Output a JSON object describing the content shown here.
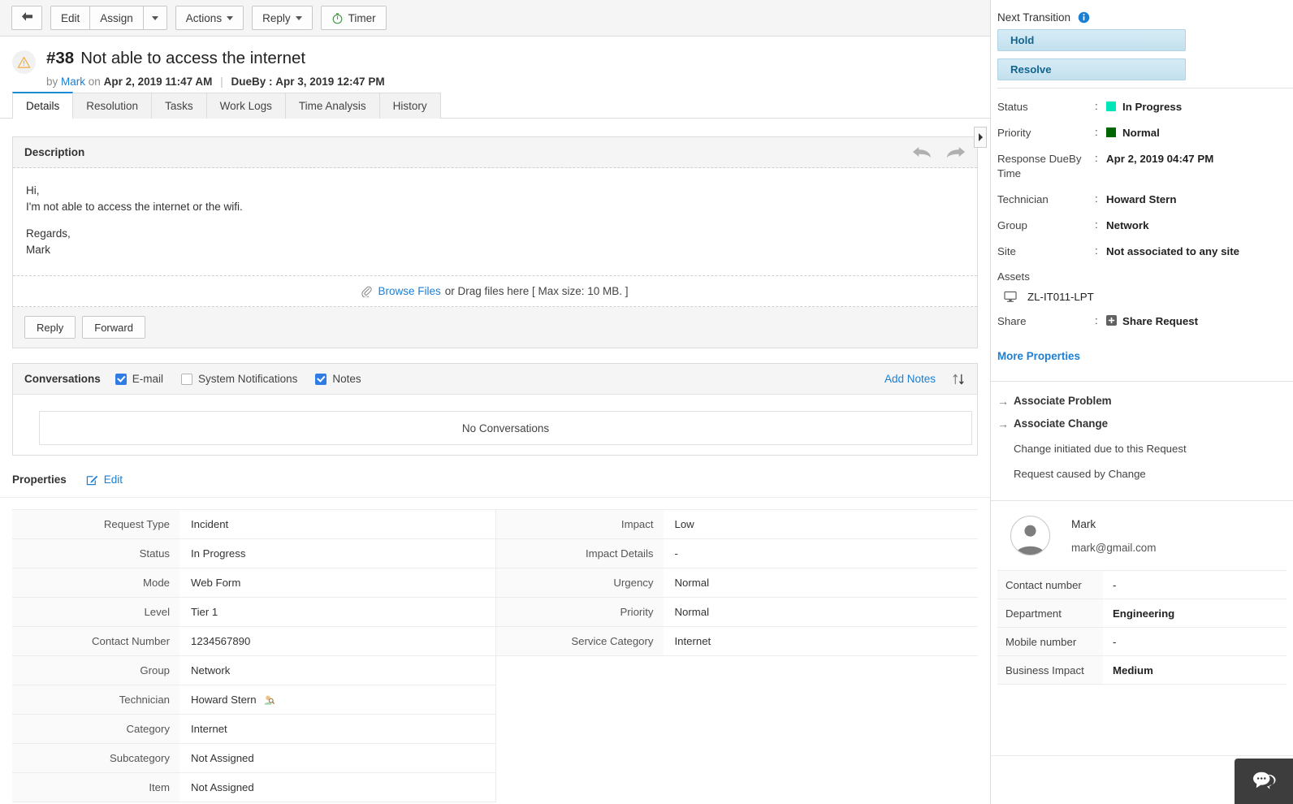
{
  "toolbar": {
    "back_label": "back-arrow",
    "edit_label": "Edit",
    "assign_label": "Assign",
    "actions_label": "Actions",
    "reply_label": "Reply",
    "timer_label": "Timer"
  },
  "request": {
    "id": "#38",
    "title": "Not able to access the internet",
    "by_prefix": "by",
    "requester": "Mark",
    "on_prefix": "on",
    "created": "Apr 2, 2019 11:47 AM",
    "dueby_label": "DueBy :",
    "dueby": "Apr 3, 2019 12:47 PM"
  },
  "tabs": [
    {
      "label": "Details",
      "active": true
    },
    {
      "label": "Resolution",
      "active": false
    },
    {
      "label": "Tasks",
      "active": false
    },
    {
      "label": "Work Logs",
      "active": false
    },
    {
      "label": "Time Analysis",
      "active": false
    },
    {
      "label": "History",
      "active": false
    }
  ],
  "description": {
    "heading": "Description",
    "line1": "Hi,",
    "line2": "I'm not able to access the internet or the wifi.",
    "line3": "Regards,",
    "line4": "Mark",
    "attach_link": "Browse Files",
    "attach_rest": "or Drag files here [ Max size: 10 MB. ]",
    "reply_button": "Reply",
    "forward_button": "Forward"
  },
  "conversations": {
    "heading": "Conversations",
    "filters": [
      {
        "label": "E-mail",
        "checked": true
      },
      {
        "label": "System Notifications",
        "checked": false
      },
      {
        "label": "Notes",
        "checked": true
      }
    ],
    "add_notes": "Add Notes",
    "empty_text": "No Conversations"
  },
  "properties": {
    "heading": "Properties",
    "edit_label": "Edit",
    "left": [
      {
        "key": "Request Type",
        "value": "Incident"
      },
      {
        "key": "Status",
        "value": "In Progress"
      },
      {
        "key": "Mode",
        "value": "Web Form"
      },
      {
        "key": "Level",
        "value": "Tier 1"
      },
      {
        "key": "Contact Number",
        "value": "1234567890"
      },
      {
        "key": "Group",
        "value": "Network"
      },
      {
        "key": "Technician",
        "value": "Howard Stern",
        "icon": "technician-icon"
      },
      {
        "key": "Category",
        "value": "Internet"
      },
      {
        "key": "Subcategory",
        "value": "Not Assigned"
      },
      {
        "key": "Item",
        "value": "Not Assigned"
      }
    ],
    "right": [
      {
        "key": "Impact",
        "value": "Low"
      },
      {
        "key": "Impact Details",
        "value": "-"
      },
      {
        "key": "Urgency",
        "value": "Normal"
      },
      {
        "key": "Priority",
        "value": "Normal"
      },
      {
        "key": "Service Category",
        "value": "Internet"
      }
    ]
  },
  "sidebar": {
    "next_transition_label": "Next Transition",
    "transitions": [
      {
        "label": "Hold"
      },
      {
        "label": "Resolve"
      }
    ],
    "fields": [
      {
        "key": "Status",
        "value": "In Progress",
        "swatch": "#00e6b8"
      },
      {
        "key": "Priority",
        "value": "Normal",
        "swatch": "#006400"
      },
      {
        "key": "Response DueBy Time",
        "value": "Apr 2, 2019 04:47 PM"
      },
      {
        "key": "Technician",
        "value": "Howard Stern"
      },
      {
        "key": "Group",
        "value": "Network"
      },
      {
        "key": "Site",
        "value": "Not associated to any site"
      }
    ],
    "assets_label": "Assets",
    "asset_name": "ZL-IT011-LPT",
    "share_key": "Share",
    "share_value": "Share Request",
    "more_properties": "More Properties",
    "associations": {
      "problem_label": "Associate Problem",
      "change_label": "Associate Change",
      "change_note": "Change initiated due to this Request",
      "caused_note": "Request caused by Change"
    },
    "user": {
      "name": "Mark",
      "email": "mark@gmail.com",
      "rows": [
        {
          "key": "Contact number",
          "value": "-",
          "bold": false
        },
        {
          "key": "Department",
          "value": "Engineering",
          "bold": true
        },
        {
          "key": "Mobile number",
          "value": "-",
          "bold": false
        },
        {
          "key": "Business Impact",
          "value": "Medium",
          "bold": true
        }
      ]
    }
  },
  "colors": {
    "accent_link": "#1b7fd4",
    "tab_active_border": "#1b8ad4",
    "checkbox_on": "#2e7ce4",
    "status_green": "#00e6b8",
    "priority_green": "#006400"
  }
}
